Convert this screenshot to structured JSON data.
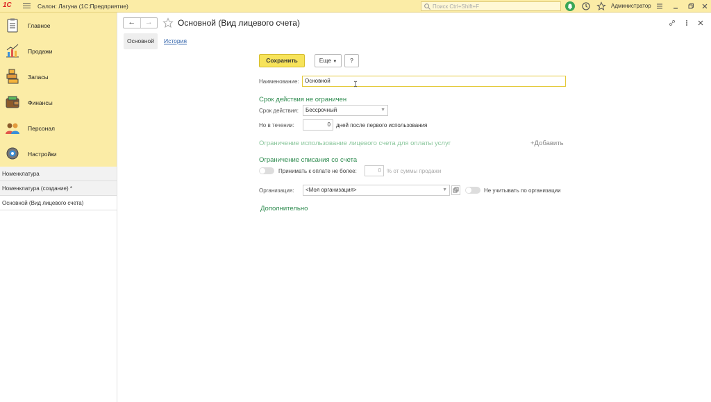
{
  "app": {
    "logo": "1С",
    "title": "Салон: Лагуна  (1С:Предприятие)",
    "search_placeholder": "Поиск Ctrl+Shift+F",
    "user": "Администратор"
  },
  "sidebar": {
    "sections": [
      {
        "label": "Главное",
        "icon": "clipboard-icon"
      },
      {
        "label": "Продажи",
        "icon": "chart-icon"
      },
      {
        "label": "Запасы",
        "icon": "boxes-icon"
      },
      {
        "label": "Финансы",
        "icon": "wallet-icon"
      },
      {
        "label": "Персонал",
        "icon": "people-icon"
      },
      {
        "label": "Настройки",
        "icon": "gear-icon"
      }
    ],
    "open_windows": [
      {
        "label": "Номенклатура"
      },
      {
        "label": "Номенклатура (создание) *"
      },
      {
        "label": "Основной (Вид лицевого счета)"
      }
    ]
  },
  "form": {
    "title": "Основной (Вид лицевого счета)",
    "tabs": {
      "main": "Основной",
      "history": "История"
    },
    "buttons": {
      "save": "Сохранить",
      "more": "Еще",
      "help": "?"
    },
    "name_label": "Наименование:",
    "name_value": "Основной",
    "validity_header": "Срок действия не ограничен",
    "validity_label": "Срок действия:",
    "validity_value": "Бессрочный",
    "within_label": "Но в течении:",
    "within_value": "0",
    "within_suffix": "дней после первого использования",
    "restriction_header": "Ограничение использование лицевого счета для оплаты услуг",
    "add_link": "+Добавить",
    "writeoff_header": "Ограничение списания со счета",
    "accept_label": "Принимать к оплате не более:",
    "accept_value": "0",
    "accept_suffix": "% от суммы продажи",
    "org_label": "Организация:",
    "org_value": "<Моя организация>",
    "org_toggle_label": "Не учитывать по организации",
    "additional": "Дополнительно"
  },
  "colors": {
    "header_bg": "#fbeca6",
    "accent_green": "#2e8b4f",
    "save_button": "#f7e35a"
  }
}
